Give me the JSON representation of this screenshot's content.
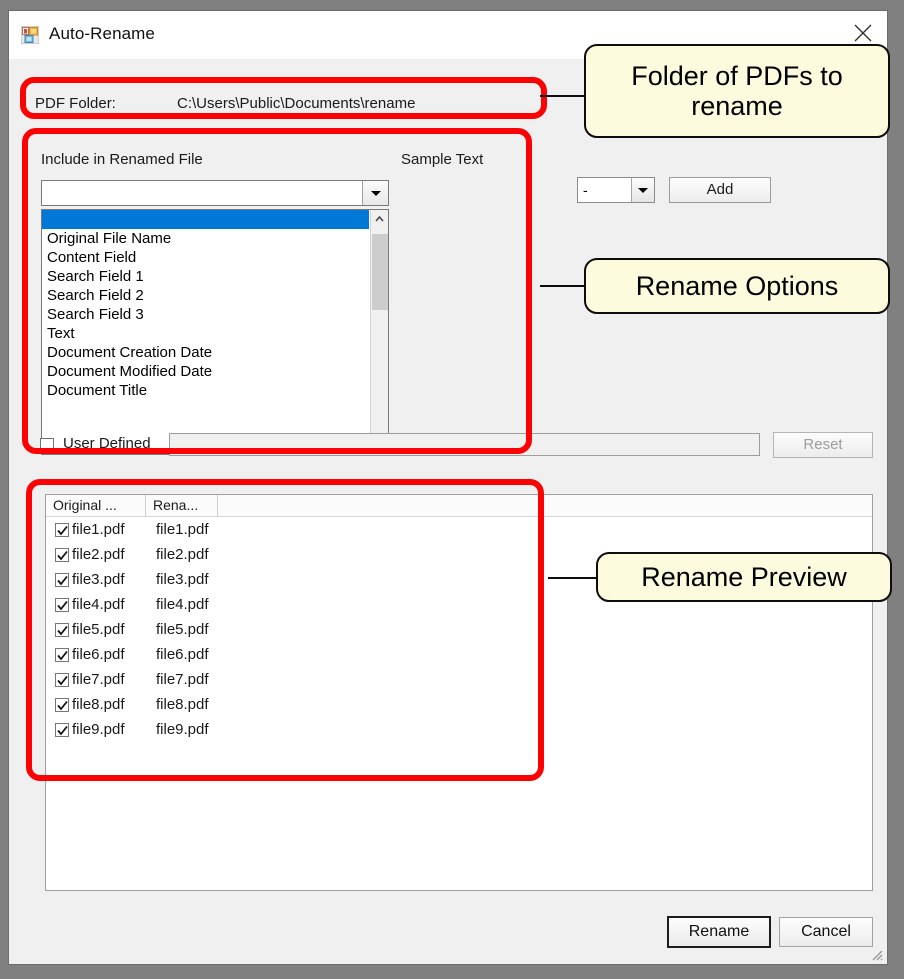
{
  "window": {
    "title": "Auto-Rename",
    "icon": "app-window-icon",
    "close_icon": "close-icon"
  },
  "folder": {
    "label": "PDF Folder:",
    "value": "C:\\Users\\Public\\Documents\\rename"
  },
  "options": {
    "include_label": "Include in Renamed File",
    "sample_label": "Sample Text",
    "field_combo_value": "",
    "field_options": [
      "",
      "Original File Name",
      "Content Field",
      "Search Field 1",
      "Search Field 2",
      "Search Field 3",
      "Text",
      "Document Creation Date",
      "Document Modified Date",
      "Document Title"
    ],
    "selected_index": 0,
    "separator_value": "-",
    "add_label": "Add",
    "user_defined_label": "User Defined",
    "user_defined_checked": false,
    "user_defined_value": "",
    "reset_label": "Reset"
  },
  "preview": {
    "columns": [
      "Original ...",
      "Rena...",
      ""
    ],
    "rows": [
      {
        "checked": true,
        "original": "file1.pdf",
        "renamed": "file1.pdf"
      },
      {
        "checked": true,
        "original": "file2.pdf",
        "renamed": "file2.pdf"
      },
      {
        "checked": true,
        "original": "file3.pdf",
        "renamed": "file3.pdf"
      },
      {
        "checked": true,
        "original": "file4.pdf",
        "renamed": "file4.pdf"
      },
      {
        "checked": true,
        "original": "file5.pdf",
        "renamed": "file5.pdf"
      },
      {
        "checked": true,
        "original": "file6.pdf",
        "renamed": "file6.pdf"
      },
      {
        "checked": true,
        "original": "file7.pdf",
        "renamed": "file7.pdf"
      },
      {
        "checked": true,
        "original": "file8.pdf",
        "renamed": "file8.pdf"
      },
      {
        "checked": true,
        "original": "file9.pdf",
        "renamed": "file9.pdf"
      }
    ]
  },
  "actions": {
    "rename_label": "Rename",
    "cancel_label": "Cancel"
  },
  "annotations": {
    "folder_callout": "Folder of PDFs to rename",
    "options_callout": "Rename Options",
    "preview_callout": "Rename Preview",
    "highlight_color": "#fb0304",
    "callout_fill": "#fdfbdd"
  }
}
